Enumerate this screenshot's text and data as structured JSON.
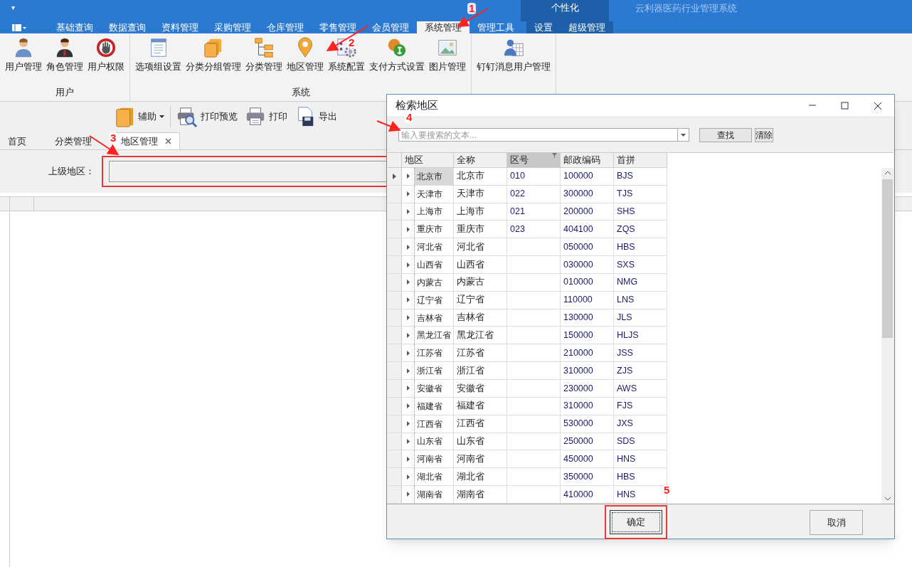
{
  "app_bar": {
    "menu_glyph": "▾",
    "personalize": "个性化",
    "app_title": "云利器医药行业管理系统"
  },
  "ribbon_tabs": [
    {
      "label": "基础查询",
      "selected": false
    },
    {
      "label": "数据查询",
      "selected": false
    },
    {
      "label": "资料管理",
      "selected": false
    },
    {
      "label": "采购管理",
      "selected": false
    },
    {
      "label": "仓库管理",
      "selected": false
    },
    {
      "label": "零售管理",
      "selected": false
    },
    {
      "label": "会员管理",
      "selected": false
    },
    {
      "label": "系统管理",
      "selected": true
    },
    {
      "label": "管理工具",
      "selected": false
    },
    {
      "label": "设置",
      "selected": false
    },
    {
      "label": "超级管理",
      "selected": false
    }
  ],
  "ribbon_groups": [
    {
      "label": "用户",
      "items": [
        {
          "label": "用户管理"
        },
        {
          "label": "角色管理"
        },
        {
          "label": "用户权限"
        }
      ]
    },
    {
      "label": "系统",
      "items": [
        {
          "label": "选项组设置"
        },
        {
          "label": "分类分组管理"
        },
        {
          "label": "分类管理"
        },
        {
          "label": "地区管理"
        },
        {
          "label": "系统配置"
        },
        {
          "label": "支付方式设置"
        },
        {
          "label": "图片管理"
        }
      ]
    },
    {
      "items": [
        {
          "label": "钉钉消息用户管理"
        }
      ]
    }
  ],
  "toolbar": [
    {
      "label": "辅助",
      "kind": "dropdown"
    },
    {
      "label": "打印预览",
      "kind": "button"
    },
    {
      "label": "打印",
      "kind": "button"
    },
    {
      "label": "导出",
      "kind": "button"
    }
  ],
  "doc_tabs": [
    {
      "label": "首页",
      "selected": false,
      "closable": false
    },
    {
      "label": "分类管理",
      "selected": false,
      "closable": false
    },
    {
      "label": "地区管理",
      "selected": true,
      "closable": true
    }
  ],
  "form": {
    "label": "上级地区："
  },
  "dialog": {
    "title": "检索地区",
    "search": {
      "placeholder": "输入要搜索的文本..."
    },
    "buttons": [
      "查找",
      "清除"
    ],
    "columns": [
      {
        "label": "地区",
        "filtered": false
      },
      {
        "label": "全称",
        "filtered": false
      },
      {
        "label": "区号",
        "filtered": true
      },
      {
        "label": "邮政编码",
        "filtered": false
      },
      {
        "label": "首拼",
        "filtered": false
      }
    ],
    "rows": [
      {
        "selected": true,
        "cells": [
          "北京市",
          "北京市",
          "010",
          "100000",
          "BJS"
        ]
      },
      {
        "selected": false,
        "cells": [
          "天津市",
          "天津市",
          "022",
          "300000",
          "TJS"
        ]
      },
      {
        "selected": false,
        "cells": [
          "上海市",
          "上海市",
          "021",
          "200000",
          "SHS"
        ]
      },
      {
        "selected": false,
        "cells": [
          "重庆市",
          "重庆市",
          "023",
          "404100",
          "ZQS"
        ]
      },
      {
        "selected": false,
        "cells": [
          "河北省",
          "河北省",
          "",
          "050000",
          "HBS"
        ]
      },
      {
        "selected": false,
        "cells": [
          "山西省",
          "山西省",
          "",
          "030000",
          "SXS"
        ]
      },
      {
        "selected": false,
        "cells": [
          "内蒙古",
          "内蒙古",
          "",
          "010000",
          "NMG"
        ]
      },
      {
        "selected": false,
        "cells": [
          "辽宁省",
          "辽宁省",
          "",
          "110000",
          "LNS"
        ]
      },
      {
        "selected": false,
        "cells": [
          "吉林省",
          "吉林省",
          "",
          "130000",
          "JLS"
        ]
      },
      {
        "selected": false,
        "cells": [
          "黑龙江省",
          "黑龙江省",
          "",
          "150000",
          "HLJS"
        ]
      },
      {
        "selected": false,
        "cells": [
          "江苏省",
          "江苏省",
          "",
          "210000",
          "JSS"
        ]
      },
      {
        "selected": false,
        "cells": [
          "浙江省",
          "浙江省",
          "",
          "310000",
          "ZJS"
        ]
      },
      {
        "selected": false,
        "cells": [
          "安徽省",
          "安徽省",
          "",
          "230000",
          "AWS"
        ]
      },
      {
        "selected": false,
        "cells": [
          "福建省",
          "福建省",
          "",
          "310000",
          "FJS"
        ]
      },
      {
        "selected": false,
        "cells": [
          "江西省",
          "江西省",
          "",
          "530000",
          "JXS"
        ]
      },
      {
        "selected": false,
        "cells": [
          "山东省",
          "山东省",
          "",
          "250000",
          "SDS"
        ]
      },
      {
        "selected": false,
        "cells": [
          "河南省",
          "河南省",
          "",
          "450000",
          "HNS"
        ]
      },
      {
        "selected": false,
        "cells": [
          "湖北省",
          "湖北省",
          "",
          "350000",
          "HBS"
        ]
      },
      {
        "selected": false,
        "cells": [
          "湖南省",
          "湖南省",
          "",
          "410000",
          "HNS"
        ]
      }
    ],
    "ok": "确定",
    "cancel": "取消"
  },
  "annotations": [
    {
      "label": "1"
    },
    {
      "label": "2"
    },
    {
      "label": "3"
    },
    {
      "label": "4"
    },
    {
      "label": "5"
    }
  ]
}
